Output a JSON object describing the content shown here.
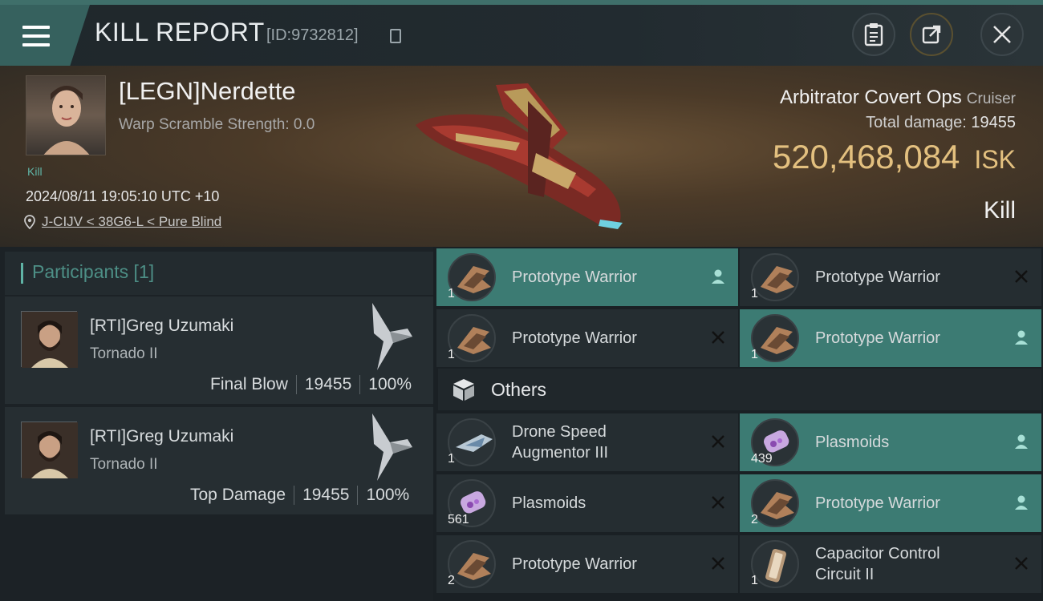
{
  "header": {
    "title": "KILL REPORT",
    "report_id": "[ID:9732812]"
  },
  "victim": {
    "name": "[LEGN]Nerdette",
    "warp_scramble": "Warp Scramble Strength: 0.0",
    "tag": "Kill",
    "timestamp": "2024/08/11 19:05:10 UTC +10",
    "location": "J-CIJV < 38G6-L < Pure Blind"
  },
  "ship": {
    "name": "Arbitrator Covert Ops",
    "class": "Cruiser",
    "total_damage_label": "Total damage:",
    "total_damage": "19455",
    "isk_value": "520,468,084",
    "isk_unit": "ISK",
    "result": "Kill"
  },
  "participants": {
    "title": "Participants [1]",
    "rows": [
      {
        "name": "[RTI]Greg Uzumaki",
        "ship": "Tornado II",
        "role": "Final Blow",
        "damage": "19455",
        "percent": "100%"
      },
      {
        "name": "[RTI]Greg Uzumaki",
        "ship": "Tornado II",
        "role": "Top Damage",
        "damage": "19455",
        "percent": "100%"
      }
    ]
  },
  "items": {
    "drones": [
      {
        "qty": "1",
        "name": "Prototype  Warrior",
        "status": "dropped"
      },
      {
        "qty": "1",
        "name": "Prototype  Warrior",
        "status": "destroyed"
      },
      {
        "qty": "1",
        "name": "Prototype  Warrior",
        "status": "destroyed"
      },
      {
        "qty": "1",
        "name": "Prototype  Warrior",
        "status": "dropped"
      }
    ],
    "others_title": "Others",
    "others": [
      {
        "qty": "1",
        "name_line1": "Drone Speed",
        "name_line2": "Augmentor III",
        "status": "destroyed"
      },
      {
        "qty": "439",
        "name_line1": "Plasmoids",
        "name_line2": "",
        "status": "dropped"
      },
      {
        "qty": "561",
        "name_line1": "Plasmoids",
        "name_line2": "",
        "status": "destroyed"
      },
      {
        "qty": "2",
        "name_line1": "Prototype  Warrior",
        "name_line2": "",
        "status": "dropped"
      },
      {
        "qty": "2",
        "name_line1": "Prototype  Warrior",
        "name_line2": "",
        "status": "destroyed"
      },
      {
        "qty": "1",
        "name_line1": "Capacitor Control",
        "name_line2": "Circuit II",
        "status": "destroyed"
      }
    ]
  },
  "icons": {
    "menu": "hamburger-icon",
    "copy": "copy-icon",
    "clipboard": "clipboard-icon",
    "share": "share-icon",
    "close": "close-icon",
    "location": "location-pin-icon",
    "dropped": "person-icon",
    "destroyed": "x-icon",
    "others": "cube-icon"
  },
  "colors": {
    "accent": "#5fb3a5",
    "highlight_row": "#3c7b73",
    "isk": "#e3c07f"
  }
}
